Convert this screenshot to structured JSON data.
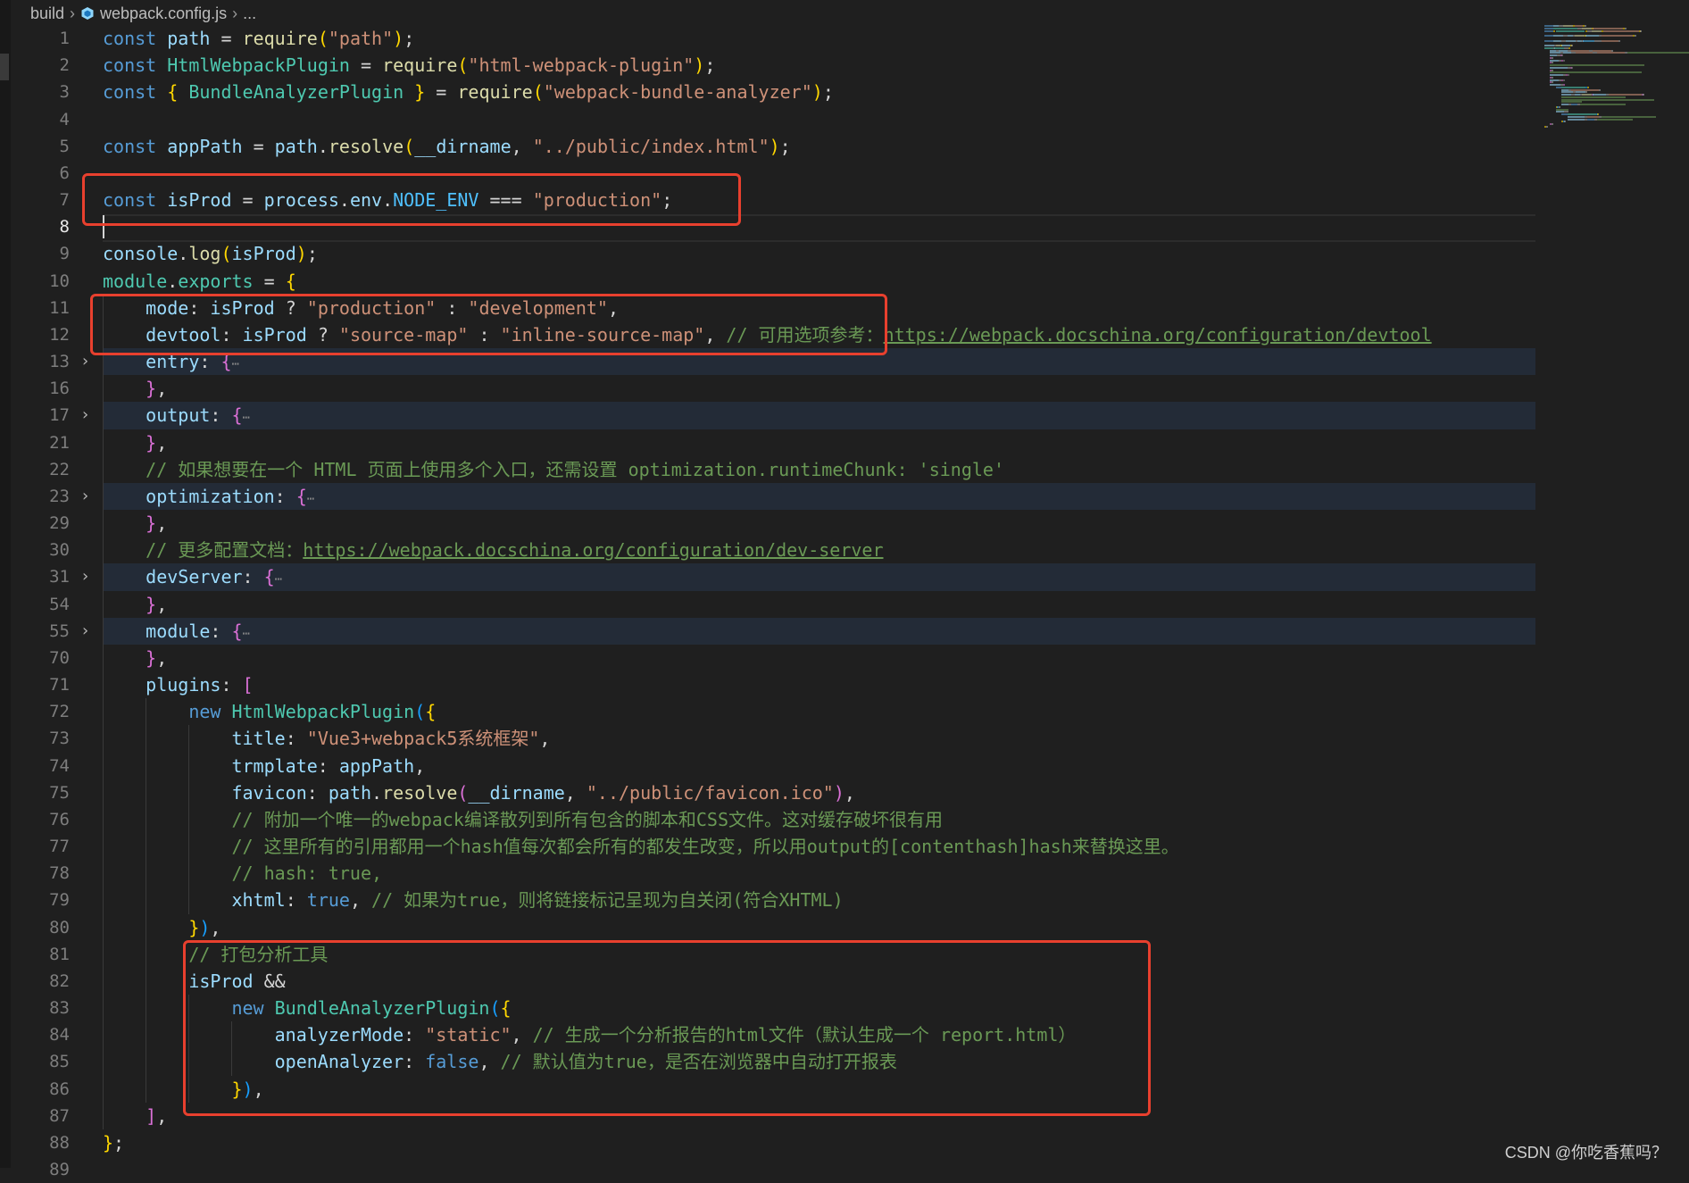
{
  "breadcrumb": {
    "items": [
      "build",
      "webpack.config.js",
      "..."
    ],
    "file_icon": "webpack-cube-icon"
  },
  "colors": {
    "background": "#1f1f1f",
    "annotation_box": "#e8402e",
    "keyword": "#569cd6",
    "string": "#ce9178",
    "comment": "#6a9955"
  },
  "current_line": 8,
  "watermark": "CSDN @你吃香蕉吗？",
  "annotation_boxes": [
    {
      "label": "isProd definition",
      "lines": [
        7,
        8
      ]
    },
    {
      "label": "mode/devtool",
      "lines": [
        11,
        12
      ]
    },
    {
      "label": "bundle analyzer",
      "lines": [
        81,
        87
      ]
    }
  ],
  "lines": [
    {
      "n": 1,
      "i": 0,
      "t": [
        [
          "k",
          "const "
        ],
        [
          "v",
          "path"
        ],
        [
          "p",
          " = "
        ],
        [
          "f",
          "require"
        ],
        [
          "b1",
          "("
        ],
        [
          "s",
          "\"path\""
        ],
        [
          "b1",
          ")"
        ],
        [
          "p",
          ";"
        ]
      ]
    },
    {
      "n": 2,
      "i": 0,
      "t": [
        [
          "k",
          "const "
        ],
        [
          "c",
          "HtmlWebpackPlugin"
        ],
        [
          "p",
          " = "
        ],
        [
          "f",
          "require"
        ],
        [
          "b1",
          "("
        ],
        [
          "s",
          "\"html-webpack-plugin\""
        ],
        [
          "b1",
          ")"
        ],
        [
          "p",
          ";"
        ]
      ]
    },
    {
      "n": 3,
      "i": 0,
      "t": [
        [
          "k",
          "const "
        ],
        [
          "b1",
          "{"
        ],
        [
          "p",
          " "
        ],
        [
          "c",
          "BundleAnalyzerPlugin"
        ],
        [
          "p",
          " "
        ],
        [
          "b1",
          "}"
        ],
        [
          "p",
          " = "
        ],
        [
          "f",
          "require"
        ],
        [
          "b1",
          "("
        ],
        [
          "s",
          "\"webpack-bundle-analyzer\""
        ],
        [
          "b1",
          ")"
        ],
        [
          "p",
          ";"
        ]
      ]
    },
    {
      "n": 4,
      "i": 0,
      "t": []
    },
    {
      "n": 5,
      "i": 0,
      "t": [
        [
          "k",
          "const "
        ],
        [
          "v",
          "appPath"
        ],
        [
          "p",
          " = "
        ],
        [
          "v",
          "path"
        ],
        [
          "p",
          "."
        ],
        [
          "f",
          "resolve"
        ],
        [
          "b1",
          "("
        ],
        [
          "v",
          "__dirname"
        ],
        [
          "p",
          ", "
        ],
        [
          "s",
          "\"../public/index.html\""
        ],
        [
          "b1",
          ")"
        ],
        [
          "p",
          ";"
        ]
      ]
    },
    {
      "n": 6,
      "i": 0,
      "t": []
    },
    {
      "n": 7,
      "i": 0,
      "t": [
        [
          "k",
          "const "
        ],
        [
          "v",
          "isProd"
        ],
        [
          "p",
          " = "
        ],
        [
          "v",
          "process"
        ],
        [
          "p",
          "."
        ],
        [
          "v",
          "env"
        ],
        [
          "p",
          "."
        ],
        [
          "n",
          "NODE_ENV"
        ],
        [
          "p",
          " === "
        ],
        [
          "s",
          "\"production\""
        ],
        [
          "p",
          ";"
        ]
      ]
    },
    {
      "n": 8,
      "i": 0,
      "t": []
    },
    {
      "n": 9,
      "i": 0,
      "t": [
        [
          "v",
          "console"
        ],
        [
          "p",
          "."
        ],
        [
          "f",
          "log"
        ],
        [
          "b1",
          "("
        ],
        [
          "v",
          "isProd"
        ],
        [
          "b1",
          ")"
        ],
        [
          "p",
          ";"
        ]
      ]
    },
    {
      "n": 10,
      "i": 0,
      "t": [
        [
          "c",
          "module"
        ],
        [
          "p",
          "."
        ],
        [
          "c",
          "exports"
        ],
        [
          "p",
          " = "
        ],
        [
          "b1",
          "{"
        ]
      ]
    },
    {
      "n": 11,
      "i": 1,
      "t": [
        [
          "v",
          "mode"
        ],
        [
          "p",
          ": "
        ],
        [
          "v",
          "isProd"
        ],
        [
          "p",
          " ? "
        ],
        [
          "s",
          "\"production\""
        ],
        [
          "p",
          " : "
        ],
        [
          "s",
          "\"development\""
        ],
        [
          "p",
          ","
        ]
      ]
    },
    {
      "n": 12,
      "i": 1,
      "t": [
        [
          "v",
          "devtool"
        ],
        [
          "p",
          ": "
        ],
        [
          "v",
          "isProd"
        ],
        [
          "p",
          " ? "
        ],
        [
          "s",
          "\"source-map\""
        ],
        [
          "p",
          " : "
        ],
        [
          "s",
          "\"inline-source-map\""
        ],
        [
          "p",
          ", "
        ],
        [
          "m",
          "// 可用选项参考："
        ],
        [
          "l",
          "https://webpack.docschina.org/configuration/devtool"
        ]
      ]
    },
    {
      "n": 13,
      "i": 1,
      "fold": true,
      "t": [
        [
          "v",
          "entry"
        ],
        [
          "p",
          ": "
        ],
        [
          "b2",
          "{"
        ],
        [
          "e",
          "⋯"
        ]
      ]
    },
    {
      "n": 16,
      "i": 1,
      "t": [
        [
          "b2",
          "}"
        ],
        [
          "p",
          ","
        ]
      ]
    },
    {
      "n": 17,
      "i": 1,
      "fold": true,
      "t": [
        [
          "v",
          "output"
        ],
        [
          "p",
          ": "
        ],
        [
          "b2",
          "{"
        ],
        [
          "e",
          "⋯"
        ]
      ]
    },
    {
      "n": 21,
      "i": 1,
      "t": [
        [
          "b2",
          "}"
        ],
        [
          "p",
          ","
        ]
      ]
    },
    {
      "n": 22,
      "i": 1,
      "t": [
        [
          "m",
          "// 如果想要在一个 HTML 页面上使用多个入口，还需设置 optimization.runtimeChunk: 'single'"
        ]
      ]
    },
    {
      "n": 23,
      "i": 1,
      "fold": true,
      "t": [
        [
          "v",
          "optimization"
        ],
        [
          "p",
          ": "
        ],
        [
          "b2",
          "{"
        ],
        [
          "e",
          "⋯"
        ]
      ]
    },
    {
      "n": 29,
      "i": 1,
      "t": [
        [
          "b2",
          "}"
        ],
        [
          "p",
          ","
        ]
      ]
    },
    {
      "n": 30,
      "i": 1,
      "t": [
        [
          "m",
          "// 更多配置文档："
        ],
        [
          "l",
          "https://webpack.docschina.org/configuration/dev-server"
        ]
      ]
    },
    {
      "n": 31,
      "i": 1,
      "fold": true,
      "t": [
        [
          "v",
          "devServer"
        ],
        [
          "p",
          ": "
        ],
        [
          "b2",
          "{"
        ],
        [
          "e",
          "⋯"
        ]
      ]
    },
    {
      "n": 54,
      "i": 1,
      "t": [
        [
          "b2",
          "}"
        ],
        [
          "p",
          ","
        ]
      ]
    },
    {
      "n": 55,
      "i": 1,
      "fold": true,
      "t": [
        [
          "v",
          "module"
        ],
        [
          "p",
          ": "
        ],
        [
          "b2",
          "{"
        ],
        [
          "e",
          "⋯"
        ]
      ]
    },
    {
      "n": 70,
      "i": 1,
      "t": [
        [
          "b2",
          "}"
        ],
        [
          "p",
          ","
        ]
      ]
    },
    {
      "n": 71,
      "i": 1,
      "t": [
        [
          "v",
          "plugins"
        ],
        [
          "p",
          ": "
        ],
        [
          "b2",
          "["
        ]
      ]
    },
    {
      "n": 72,
      "i": 2,
      "t": [
        [
          "k",
          "new "
        ],
        [
          "c",
          "HtmlWebpackPlugin"
        ],
        [
          "b3",
          "("
        ],
        [
          "b1",
          "{"
        ]
      ]
    },
    {
      "n": 73,
      "i": 3,
      "t": [
        [
          "v",
          "title"
        ],
        [
          "p",
          ": "
        ],
        [
          "s",
          "\"Vue3+webpack5系统框架\""
        ],
        [
          "p",
          ","
        ]
      ]
    },
    {
      "n": 74,
      "i": 3,
      "t": [
        [
          "v",
          "trmplate"
        ],
        [
          "p",
          ": "
        ],
        [
          "v",
          "appPath"
        ],
        [
          "p",
          ","
        ]
      ]
    },
    {
      "n": 75,
      "i": 3,
      "t": [
        [
          "v",
          "favicon"
        ],
        [
          "p",
          ": "
        ],
        [
          "v",
          "path"
        ],
        [
          "p",
          "."
        ],
        [
          "f",
          "resolve"
        ],
        [
          "b2",
          "("
        ],
        [
          "v",
          "__dirname"
        ],
        [
          "p",
          ", "
        ],
        [
          "s",
          "\"../public/favicon.ico\""
        ],
        [
          "b2",
          ")"
        ],
        [
          "p",
          ","
        ]
      ]
    },
    {
      "n": 76,
      "i": 3,
      "t": [
        [
          "m",
          "// 附加一个唯一的webpack编译散列到所有包含的脚本和CSS文件。这对缓存破坏很有用"
        ]
      ]
    },
    {
      "n": 77,
      "i": 3,
      "t": [
        [
          "m",
          "// 这里所有的引用都用一个hash值每次都会所有的都发生改变，所以用output的[contenthash]hash来替换这里。"
        ]
      ]
    },
    {
      "n": 78,
      "i": 3,
      "t": [
        [
          "m",
          "// hash: true,"
        ]
      ]
    },
    {
      "n": 79,
      "i": 3,
      "t": [
        [
          "v",
          "xhtml"
        ],
        [
          "p",
          ": "
        ],
        [
          "k",
          "true"
        ],
        [
          "p",
          ", "
        ],
        [
          "m",
          "// 如果为true，则将链接标记呈现为自关闭(符合XHTML)"
        ]
      ]
    },
    {
      "n": 80,
      "i": 2,
      "t": [
        [
          "b1",
          "}"
        ],
        [
          "b3",
          ")"
        ],
        [
          "p",
          ","
        ]
      ]
    },
    {
      "n": 81,
      "i": 2,
      "t": [
        [
          "m",
          "// 打包分析工具"
        ]
      ]
    },
    {
      "n": 82,
      "i": 2,
      "t": [
        [
          "v",
          "isProd"
        ],
        [
          "p",
          " &&"
        ]
      ]
    },
    {
      "n": 83,
      "i": 3,
      "t": [
        [
          "k",
          "new "
        ],
        [
          "c",
          "BundleAnalyzerPlugin"
        ],
        [
          "b3",
          "("
        ],
        [
          "b1",
          "{"
        ]
      ]
    },
    {
      "n": 84,
      "i": 4,
      "t": [
        [
          "v",
          "analyzerMode"
        ],
        [
          "p",
          ": "
        ],
        [
          "s",
          "\"static\""
        ],
        [
          "p",
          ", "
        ],
        [
          "m",
          "// 生成一个分析报告的html文件（默认生成一个 report.html）"
        ]
      ]
    },
    {
      "n": 85,
      "i": 4,
      "t": [
        [
          "v",
          "openAnalyzer"
        ],
        [
          "p",
          ": "
        ],
        [
          "k",
          "false"
        ],
        [
          "p",
          ", "
        ],
        [
          "m",
          "// 默认值为true，是否在浏览器中自动打开报表"
        ]
      ]
    },
    {
      "n": 86,
      "i": 3,
      "t": [
        [
          "b1",
          "}"
        ],
        [
          "b3",
          ")"
        ],
        [
          "p",
          ","
        ]
      ]
    },
    {
      "n": 87,
      "i": 1,
      "t": [
        [
          "b2",
          "]"
        ],
        [
          "p",
          ","
        ]
      ]
    },
    {
      "n": 88,
      "i": 0,
      "t": [
        [
          "b1",
          "}"
        ],
        [
          "p",
          ";"
        ]
      ]
    },
    {
      "n": 89,
      "i": 0,
      "t": []
    }
  ]
}
